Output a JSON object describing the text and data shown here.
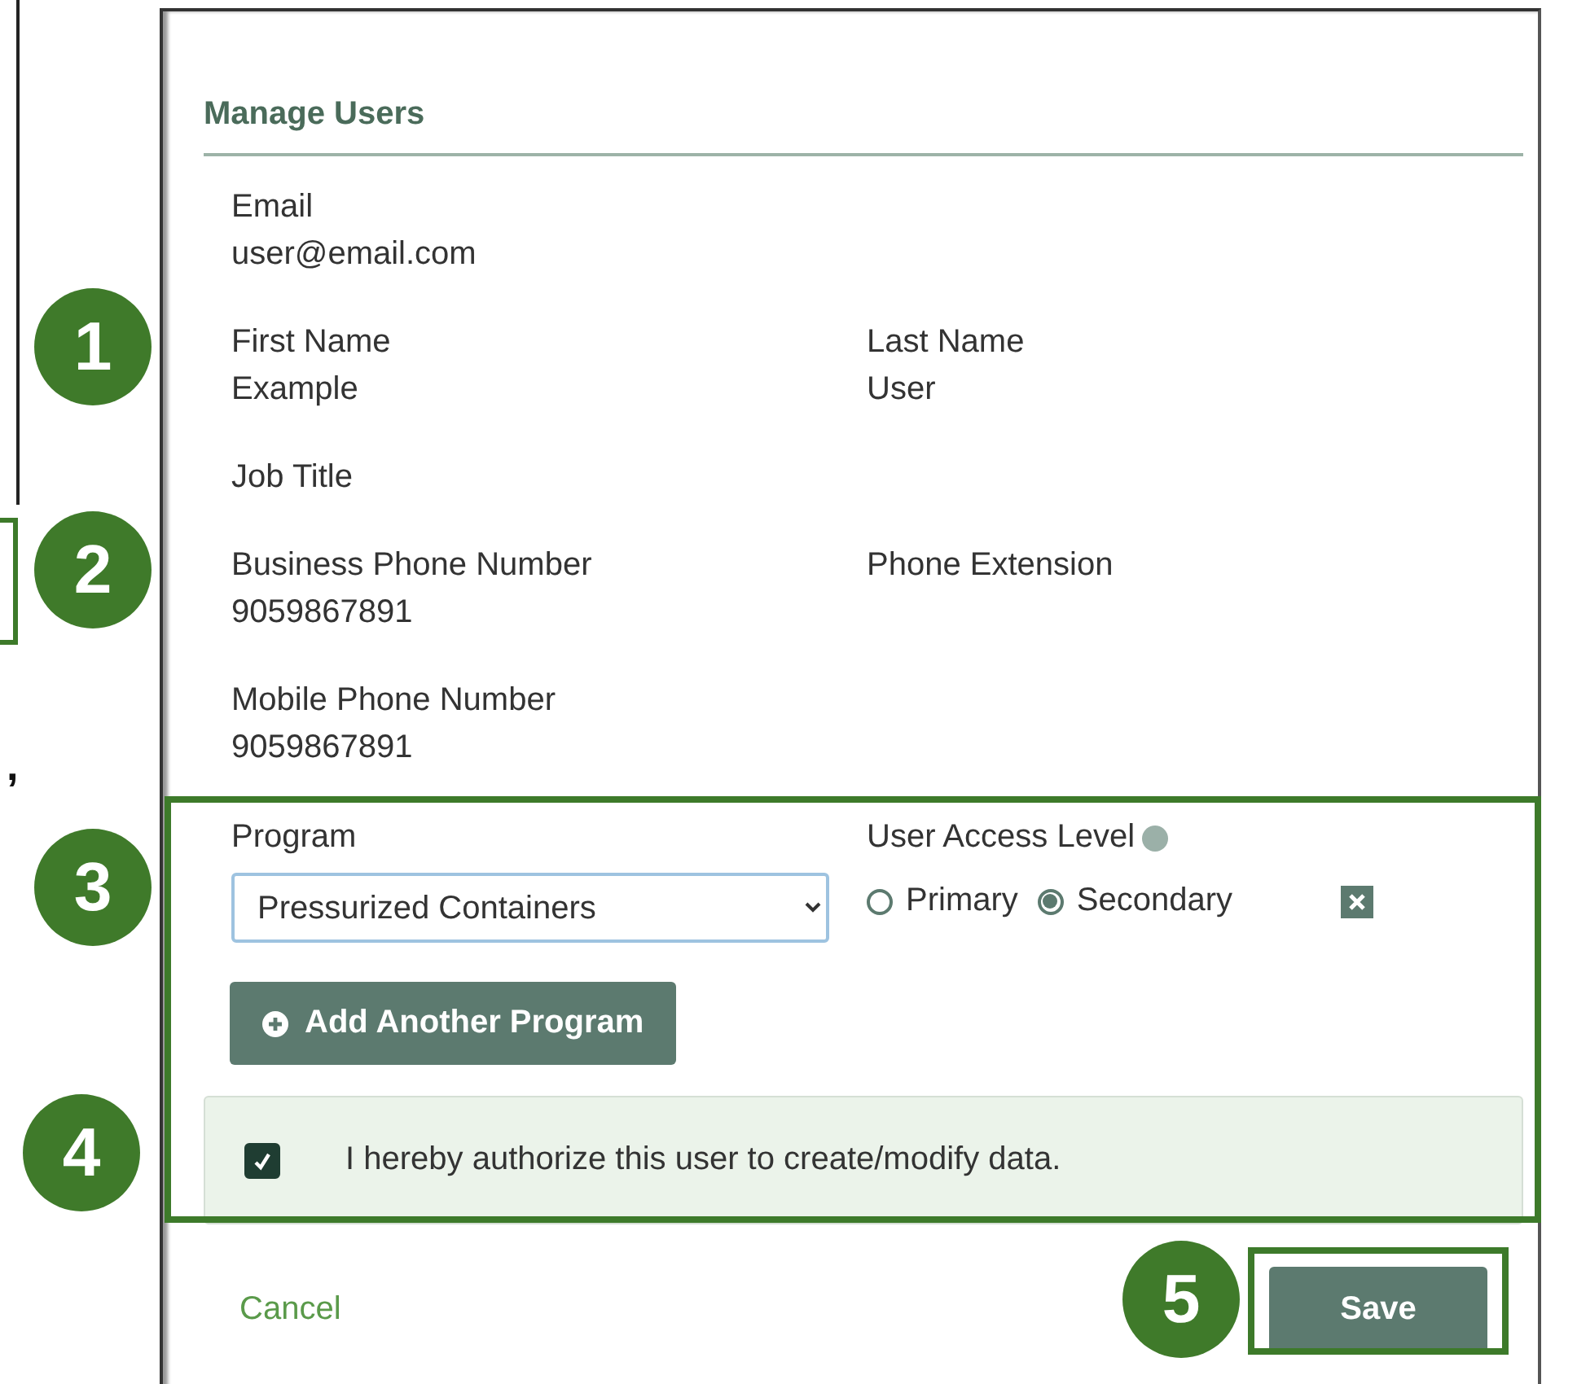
{
  "background": {
    "text": ","
  },
  "dialog": {
    "title": "Manage Users",
    "field_rows": [
      [
        {
          "label": "Email",
          "value": "user@email.com"
        }
      ],
      [
        {
          "label": "First Name",
          "value": "Example"
        },
        {
          "label": "Last Name",
          "value": "User"
        }
      ],
      [
        {
          "label": "Job Title"
        }
      ],
      [
        {
          "label": "Business Phone Number",
          "value": "9059867891"
        },
        {
          "label": "Phone Extension"
        }
      ],
      [
        {
          "label": "Mobile Phone Number",
          "value": "9059867891"
        }
      ]
    ],
    "program": {
      "label": "Program",
      "value": "Pressurized Containers"
    },
    "access": {
      "label": "User Access Level",
      "options": [
        {
          "label": "Primary",
          "selected": false
        },
        {
          "label": "Secondary",
          "selected": true
        }
      ]
    },
    "add_button": "Add Another Program",
    "authorize": {
      "text": "I hereby authorize this user to create/modify data.",
      "checked": true
    },
    "cancel": "Cancel",
    "save": "Save"
  },
  "callouts": [
    "1",
    "2",
    "3",
    "4",
    "5"
  ]
}
